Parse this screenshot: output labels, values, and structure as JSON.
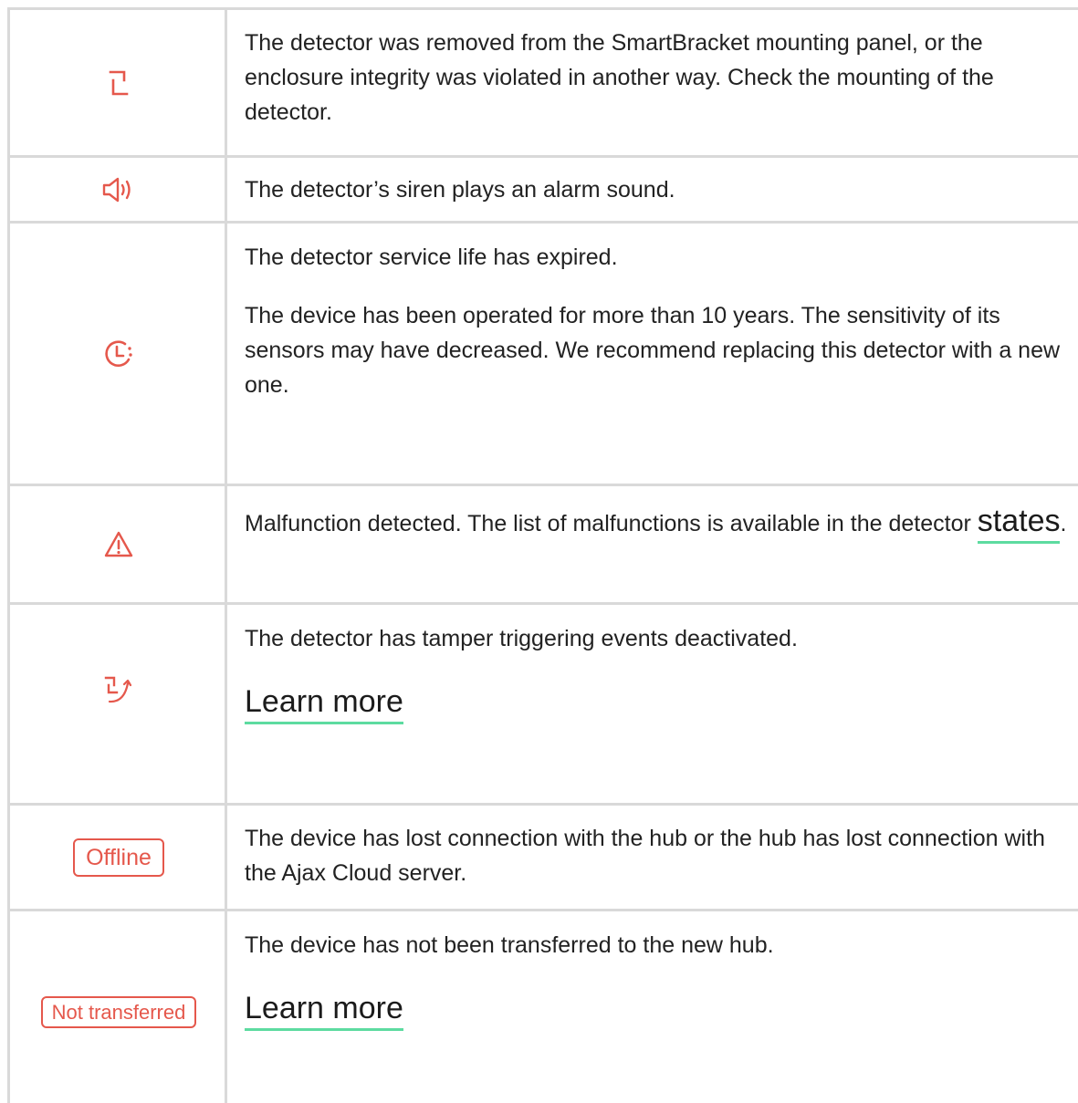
{
  "accent_color": "#e5584c",
  "link_underline_color": "#5ddba0",
  "rows": [
    {
      "icon": "tamper-icon",
      "lines": [
        "The detector was removed from the SmartBracket mounting panel, or the enclosure integrity was violated in another way. Check the mounting of the detector."
      ]
    },
    {
      "icon": "speaker-icon",
      "lines": [
        "The detector’s siren plays an alarm sound."
      ]
    },
    {
      "icon": "service-life-clock-icon",
      "lines": [
        "The detector service life has expired.",
        "The device has been operated for more than 10 years. The sensitivity of its sensors may have decreased. We recommend replacing this detector with a new one."
      ]
    },
    {
      "icon": "warning-triangle-icon",
      "text_before_link": "Malfunction detected. The list of malfunctions is available in the detector ",
      "link": "states",
      "text_after_link": "."
    },
    {
      "icon": "tamper-deactivated-icon",
      "lines": [
        "The detector has tamper triggering events deactivated."
      ],
      "link": "Learn more"
    },
    {
      "badge": "Offline",
      "lines": [
        "The device has lost connection with the hub or the hub has lost connection with the Ajax Cloud server."
      ]
    },
    {
      "badge": "Not transferred",
      "lines": [
        "The device has not been transferred to the new hub."
      ],
      "link": "Learn more"
    }
  ]
}
